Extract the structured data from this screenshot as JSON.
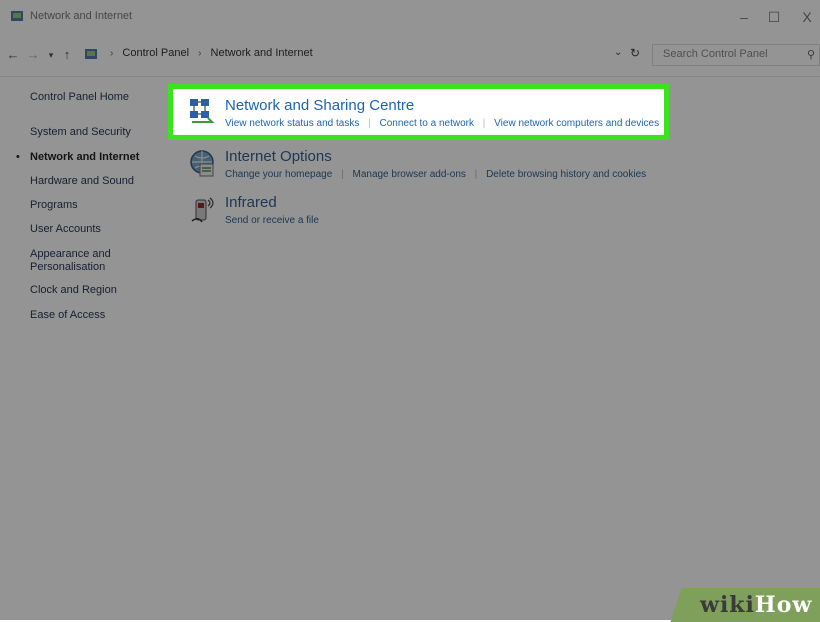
{
  "window": {
    "title": "Network and Internet"
  },
  "window_controls": {
    "minimize": "–",
    "maximize": "☐",
    "close": "X"
  },
  "address_bar": {
    "breadcrumb": [
      "Control Panel",
      "Network and Internet"
    ],
    "search_placeholder": "Search Control Panel"
  },
  "sidebar": {
    "items": [
      {
        "label": "Control Panel Home",
        "active": false
      },
      {
        "label": "System and Security",
        "active": false
      },
      {
        "label": "Network and Internet",
        "active": true
      },
      {
        "label": "Hardware and Sound",
        "active": false
      },
      {
        "label": "Programs",
        "active": false
      },
      {
        "label": "User Accounts",
        "active": false
      },
      {
        "label": "Appearance and Personalisation",
        "active": false
      },
      {
        "label": "Clock and Region",
        "active": false
      },
      {
        "label": "Ease of Access",
        "active": false
      }
    ]
  },
  "categories": [
    {
      "title": "Network and Sharing Centre",
      "icon": "network-sharing-icon",
      "links": [
        "View network status and tasks",
        "Connect to a network",
        "View network computers and devices"
      ],
      "highlighted": true
    },
    {
      "title": "Internet Options",
      "icon": "internet-options-icon",
      "links": [
        "Change your homepage",
        "Manage browser add-ons",
        "Delete browsing history and cookies"
      ],
      "highlighted": false
    },
    {
      "title": "Infrared",
      "icon": "infrared-icon",
      "links": [
        "Send or receive a file"
      ],
      "highlighted": false
    }
  ],
  "colors": {
    "highlight": "#3de21e",
    "link": "#1d64b0",
    "watermark": "#7fa05a"
  },
  "watermark": {
    "part1": "wiki",
    "part2": "How"
  }
}
